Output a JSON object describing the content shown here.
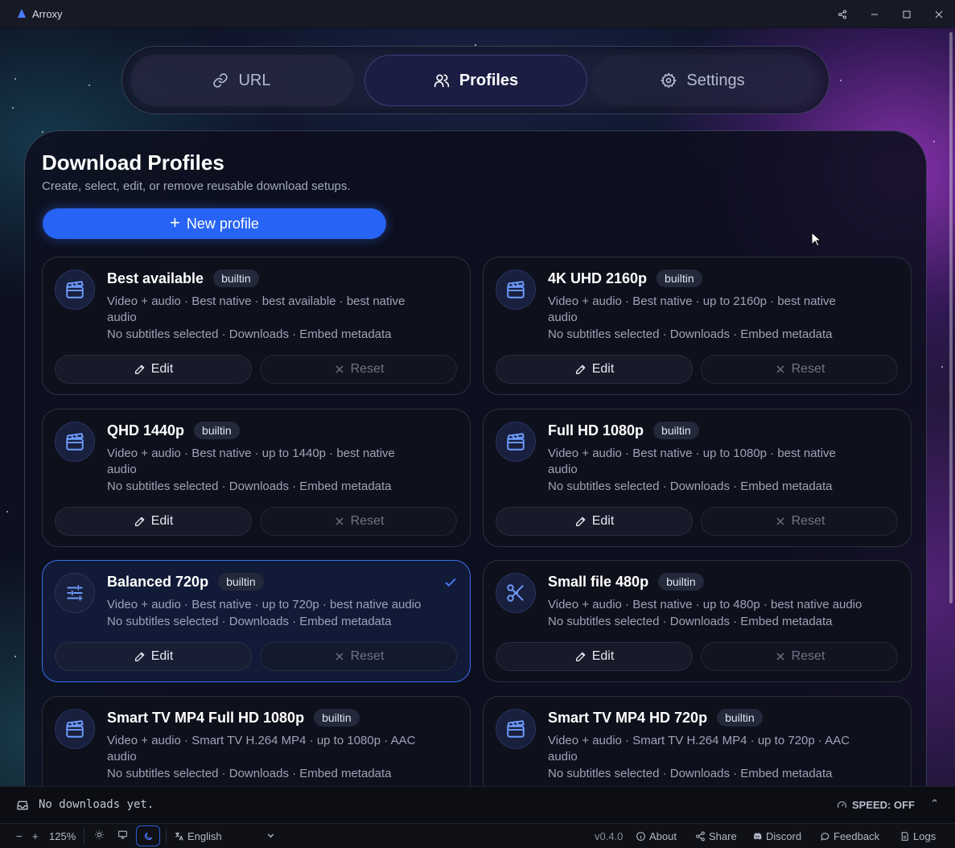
{
  "window": {
    "title": "Arroxy"
  },
  "tabs": [
    {
      "label": "URL",
      "icon": "link-icon",
      "active": false
    },
    {
      "label": "Profiles",
      "icon": "users-icon",
      "active": true
    },
    {
      "label": "Settings",
      "icon": "gear-icon",
      "active": false
    }
  ],
  "panel": {
    "title": "Download Profiles",
    "subtitle": "Create, select, edit, or remove reusable download setups.",
    "new_button": "New profile"
  },
  "card_labels": {
    "edit": "Edit",
    "reset": "Reset"
  },
  "profiles": [
    {
      "name": "Best available",
      "badge": "builtin",
      "icon": "clapperboard-icon",
      "line1": "Video + audio · Best native · best available · best native",
      "line1b": "audio",
      "line2": "No subtitles selected · Downloads · Embed metadata",
      "selected": false
    },
    {
      "name": "4K UHD 2160p",
      "badge": "builtin",
      "icon": "clapperboard-icon",
      "line1": "Video + audio · Best native · up to 2160p · best native",
      "line1b": "audio",
      "line2": "No subtitles selected · Downloads · Embed metadata",
      "selected": false
    },
    {
      "name": "QHD 1440p",
      "badge": "builtin",
      "icon": "clapperboard-icon",
      "line1": "Video + audio · Best native · up to 1440p · best native",
      "line1b": "audio",
      "line2": "No subtitles selected · Downloads · Embed metadata",
      "selected": false
    },
    {
      "name": "Full HD 1080p",
      "badge": "builtin",
      "icon": "clapperboard-icon",
      "line1": "Video + audio · Best native · up to 1080p · best native",
      "line1b": "audio",
      "line2": "No subtitles selected · Downloads · Embed metadata",
      "selected": false
    },
    {
      "name": "Balanced 720p",
      "badge": "builtin",
      "icon": "sliders-icon",
      "line1": "Video + audio · Best native · up to 720p · best native audio",
      "line1b": "",
      "line2": "No subtitles selected · Downloads · Embed metadata",
      "selected": true
    },
    {
      "name": "Small file 480p",
      "badge": "builtin",
      "icon": "scissors-icon",
      "line1": "Video + audio · Best native · up to 480p · best native audio",
      "line1b": "",
      "line2": "No subtitles selected · Downloads · Embed metadata",
      "selected": false
    },
    {
      "name": "Smart TV MP4 Full HD 1080p",
      "badge": "builtin",
      "icon": "clapperboard-icon",
      "line1": "Video + audio · Smart TV H.264 MP4 · up to 1080p · AAC",
      "line1b": "audio",
      "line2": "No subtitles selected · Downloads · Embed metadata",
      "selected": false
    },
    {
      "name": "Smart TV MP4 HD 720p",
      "badge": "builtin",
      "icon": "clapperboard-icon",
      "line1": "Video + audio · Smart TV H.264 MP4 · up to 720p · AAC",
      "line1b": "audio",
      "line2": "No subtitles selected · Downloads · Embed metadata",
      "selected": false
    }
  ],
  "status": {
    "message": "No downloads yet.",
    "speed": "SPEED: OFF"
  },
  "bottombar": {
    "zoom_minus": "−",
    "zoom_plus": "+",
    "zoom_level": "125%",
    "language": "English",
    "version": "v0.4.0",
    "about": "About",
    "share": "Share",
    "discord": "Discord",
    "feedback": "Feedback",
    "logs": "Logs"
  },
  "colors": {
    "accent": "#2763f4",
    "selected_border": "#3d6ff0"
  }
}
